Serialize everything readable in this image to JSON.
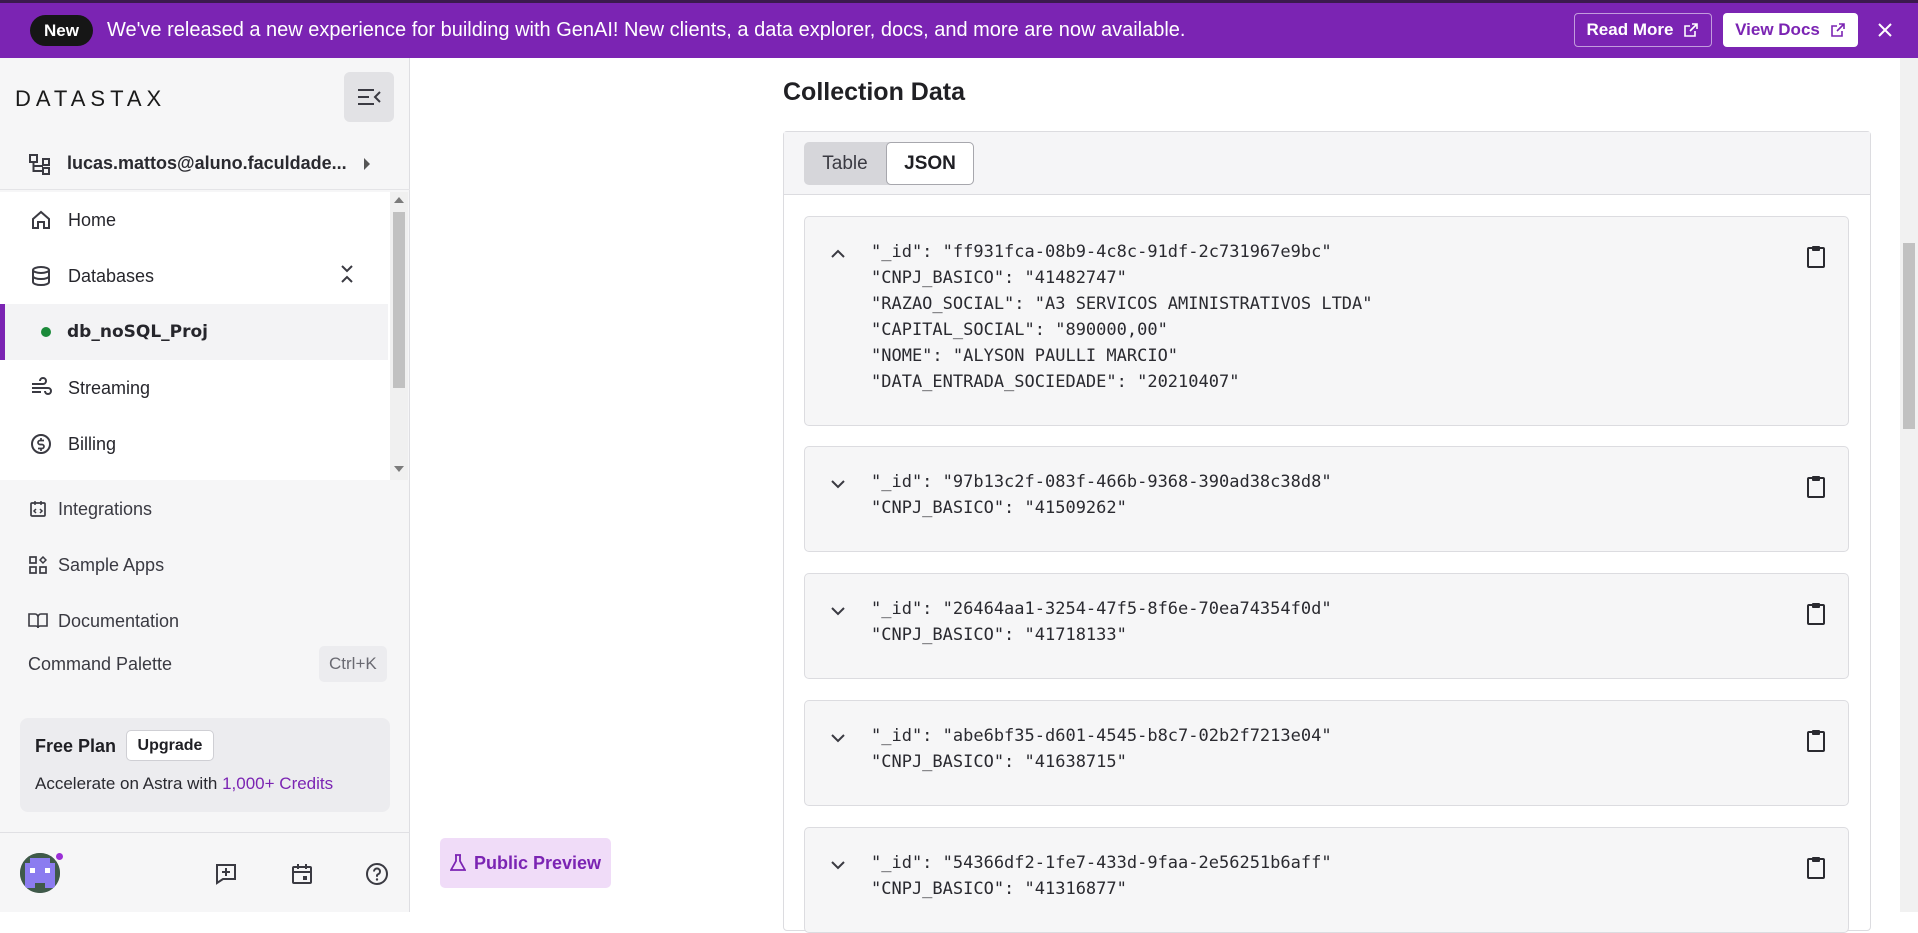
{
  "banner": {
    "badge": "New",
    "message": "We've released a new experience for building with GenAI! New clients, a data explorer, docs, and more are now available.",
    "read_more": "Read More",
    "view_docs": "View Docs"
  },
  "sidebar": {
    "logo": "DATASTAX",
    "org_label": "lucas.mattos@aluno.faculdade...",
    "nav": [
      {
        "label": "Home",
        "icon": "home-icon"
      },
      {
        "label": "Databases",
        "icon": "database-icon"
      },
      {
        "label": "db_noSQL_Proj",
        "icon": "status-dot",
        "status_color": "#1b8a3a"
      },
      {
        "label": "Streaming",
        "icon": "streaming-icon"
      },
      {
        "label": "Billing",
        "icon": "dollar-icon"
      }
    ],
    "secondary_nav": [
      {
        "label": "Integrations",
        "icon": "integrations-icon"
      },
      {
        "label": "Sample Apps",
        "icon": "apps-icon"
      },
      {
        "label": "Documentation",
        "icon": "book-icon"
      }
    ],
    "command_palette": {
      "label": "Command Palette",
      "shortcut": "Ctrl+K"
    },
    "plan": {
      "title": "Free Plan",
      "upgrade": "Upgrade",
      "desc_prefix": "Accelerate on Astra with ",
      "desc_link": "1,000+ Credits"
    }
  },
  "main": {
    "title": "Collection Data",
    "tabs": [
      {
        "label": "Table",
        "active": false
      },
      {
        "label": "JSON",
        "active": true
      }
    ],
    "documents": [
      {
        "expanded": true,
        "lines": [
          "\"_id\": \"ff931fca-08b9-4c8c-91df-2c731967e9bc\"",
          "\"CNPJ_BASICO\": \"41482747\"",
          "\"RAZAO_SOCIAL\": \"A3 SERVICOS AMINISTRATIVOS LTDA\"",
          "\"CAPITAL_SOCIAL\": \"890000,00\"",
          "\"NOME\": \"ALYSON PAULLI MARCIO\"",
          "\"DATA_ENTRADA_SOCIEDADE\": \"20210407\""
        ]
      },
      {
        "expanded": false,
        "lines": [
          "\"_id\": \"97b13c2f-083f-466b-9368-390ad38c38d8\"",
          "\"CNPJ_BASICO\": \"41509262\""
        ]
      },
      {
        "expanded": false,
        "lines": [
          "\"_id\": \"26464aa1-3254-47f5-8f6e-70ea74354f0d\"",
          "\"CNPJ_BASICO\": \"41718133\""
        ]
      },
      {
        "expanded": false,
        "lines": [
          "\"_id\": \"abe6bf35-d601-4545-b8c7-02b2f7213e04\"",
          "\"CNPJ_BASICO\": \"41638715\""
        ]
      },
      {
        "expanded": false,
        "lines": [
          "\"_id\": \"54366df2-1fe7-433d-9faa-2e56251b6aff\"",
          "\"CNPJ_BASICO\": \"41316877\""
        ]
      }
    ],
    "preview_badge": "Public Preview"
  },
  "colors": {
    "brand": "#7b24b3",
    "banner_bg": "#7b24b3",
    "status_green": "#1b8a3a"
  }
}
